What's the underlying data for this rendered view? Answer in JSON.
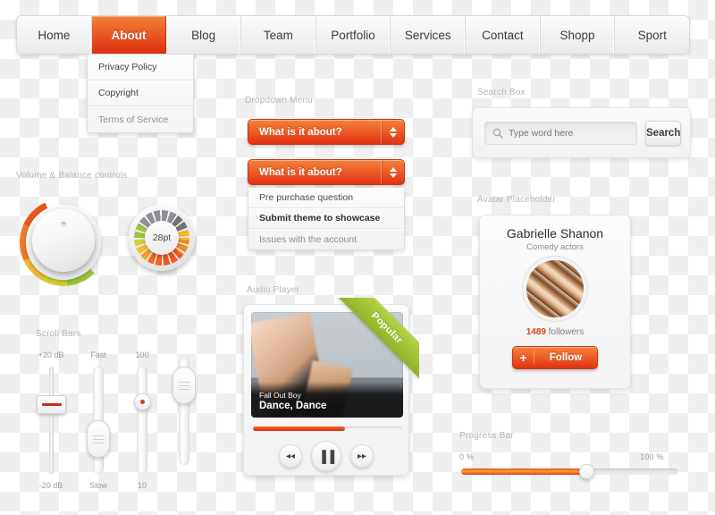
{
  "nav": {
    "items": [
      {
        "label": "Home",
        "active": false
      },
      {
        "label": "About",
        "active": true
      },
      {
        "label": "Blog",
        "active": false
      },
      {
        "label": "Team",
        "active": false
      },
      {
        "label": "Portfolio",
        "active": false
      },
      {
        "label": "Services",
        "active": false
      },
      {
        "label": "Contact",
        "active": false
      },
      {
        "label": "Shopp",
        "active": false
      },
      {
        "label": "Sport",
        "active": false
      }
    ],
    "dropdown": [
      "Privacy Policy",
      "Copyright",
      "Terms of Service"
    ]
  },
  "knobs": {
    "label": "Volume & Balance controls",
    "small_value": "28pt"
  },
  "scrollbars": {
    "label": "Scroll Bars",
    "sliders": [
      {
        "top": "+20 dB",
        "bottom": "-20 dB"
      },
      {
        "top": "Fast",
        "bottom": "Slow"
      },
      {
        "top": "100",
        "bottom": "10"
      },
      {
        "top": "",
        "bottom": ""
      }
    ]
  },
  "dropdown_menu": {
    "label": "Dropdown Menu",
    "button_label": "What is it about?",
    "button2_label": "What is it about?",
    "options": [
      "Pre purchase question",
      "Submit theme to showcase",
      "Issues with the account"
    ]
  },
  "audio_player": {
    "label": "Audio Player",
    "ribbon": "Popular",
    "artist": "Fall Out Boy",
    "song": "Dance, Dance",
    "progress_percent": 62,
    "controls": {
      "prev": "◂◂",
      "pause": "▐▐",
      "next": "▸▸"
    }
  },
  "search": {
    "label": "Search Box",
    "placeholder": "Type word here",
    "value": "",
    "button_label": "Search"
  },
  "avatar": {
    "label": "Avatar Placeholder",
    "name": "Gabrielle Shanon",
    "role": "Comedy actors",
    "followers_count": "1489",
    "followers_word": " followers",
    "follow_plus": "+",
    "follow_label": "Follow"
  },
  "progress_bar": {
    "label": "Progress Bar",
    "min": "0 %",
    "max": "100 %",
    "value_percent": 58
  },
  "colors": {
    "accent_orange": "#e23214",
    "accent_orange_light": "#f3833d",
    "ribbon_green": "#8fb327",
    "muted_text": "#b6b6b6"
  }
}
